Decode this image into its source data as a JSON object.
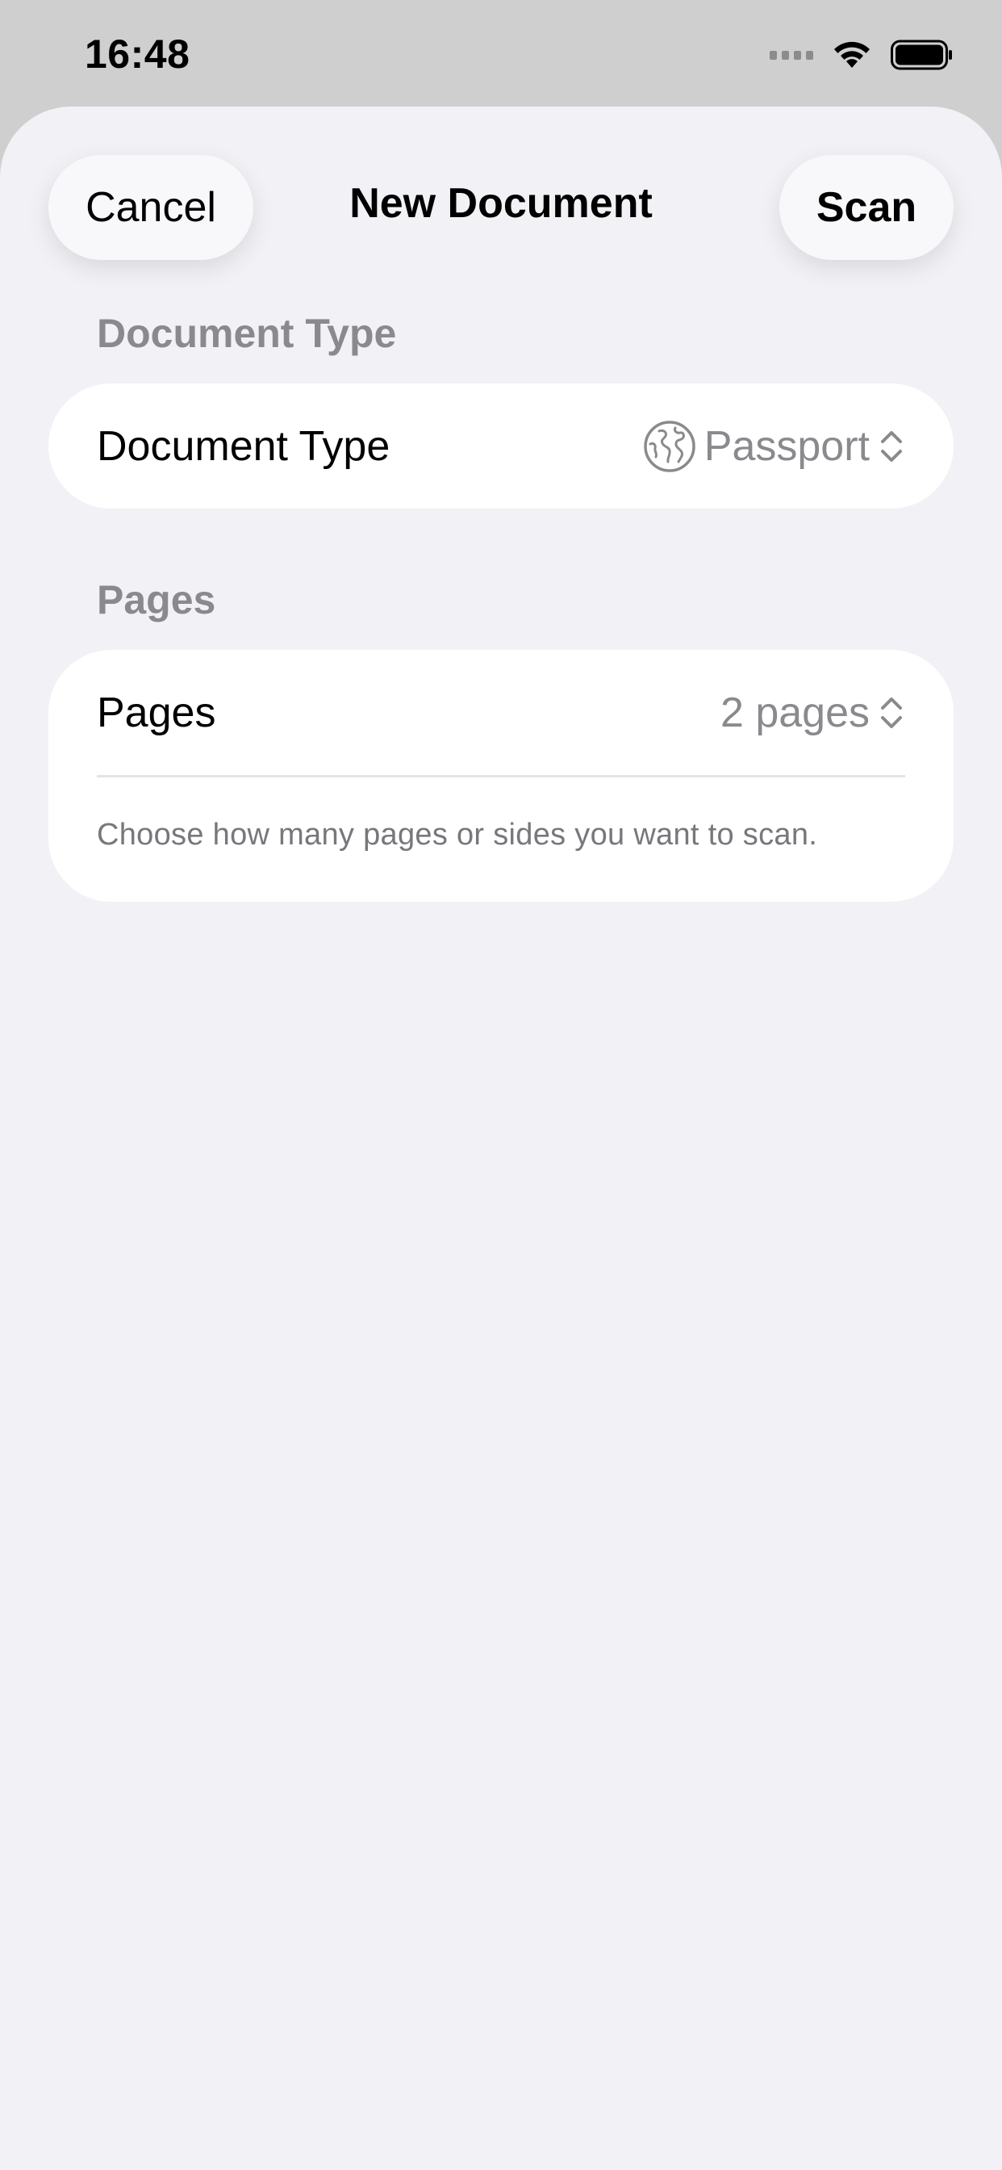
{
  "status_bar": {
    "time": "16:48",
    "icons": [
      "cellular-signal-icon",
      "wifi-icon",
      "battery-icon"
    ]
  },
  "nav": {
    "cancel_label": "Cancel",
    "title": "New Document",
    "scan_label": "Scan"
  },
  "sections": {
    "document_type": {
      "header": "Document Type",
      "row_label": "Document Type",
      "value": "Passport",
      "value_icon": "globe-icon"
    },
    "pages": {
      "header": "Pages",
      "row_label": "Pages",
      "value": "2 pages",
      "footnote": "Choose how many pages or sides you want to scan."
    }
  },
  "colors": {
    "sheet_background": "#f2f1f6",
    "secondary_text": "#8a8a8e",
    "card_background": "#ffffff"
  }
}
